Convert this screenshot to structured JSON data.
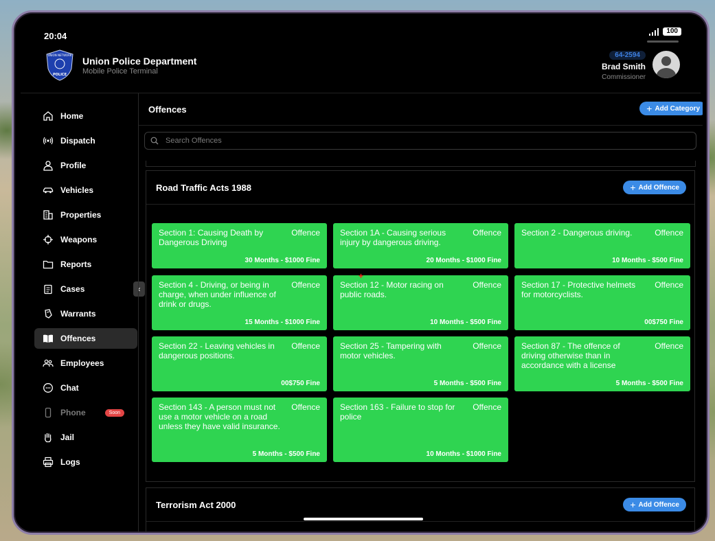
{
  "status": {
    "time": "20:04",
    "battery": "100"
  },
  "brand": {
    "title": "Union Police Department",
    "subtitle": "Mobile Police Terminal",
    "badge_top": "UNION NETWORK",
    "badge_bottom": "POLICE"
  },
  "user": {
    "callsign": "64-2594",
    "name": "Brad Smith",
    "rank": "Commissioner"
  },
  "nav": [
    {
      "label": "Home",
      "icon": "home-icon"
    },
    {
      "label": "Dispatch",
      "icon": "broadcast-icon"
    },
    {
      "label": "Profile",
      "icon": "user-icon"
    },
    {
      "label": "Vehicles",
      "icon": "car-icon"
    },
    {
      "label": "Properties",
      "icon": "building-icon"
    },
    {
      "label": "Weapons",
      "icon": "crosshair-icon"
    },
    {
      "label": "Reports",
      "icon": "folder-icon"
    },
    {
      "label": "Cases",
      "icon": "clipboard-icon"
    },
    {
      "label": "Warrants",
      "icon": "hand-paper-icon"
    },
    {
      "label": "Offences",
      "icon": "book-icon",
      "active": true
    },
    {
      "label": "Employees",
      "icon": "users-icon"
    },
    {
      "label": "Chat",
      "icon": "chat-icon"
    },
    {
      "label": "Phone",
      "icon": "phone-icon",
      "disabled": true,
      "badge": "Soon"
    },
    {
      "label": "Jail",
      "icon": "hand-icon"
    },
    {
      "label": "Logs",
      "icon": "printer-icon"
    }
  ],
  "main": {
    "title": "Offences",
    "add_category": "Add Category",
    "search_placeholder": "Search Offences",
    "categories": [
      {
        "title": "Road Traffic Acts 1988",
        "add_label": "Add Offence",
        "offences": [
          {
            "title": "Section 1: Causing Death by Dangerous Driving",
            "tag": "Offence",
            "fine": "30 Months - $1000 Fine"
          },
          {
            "title": "Section 1A - Causing serious injury by dangerous driving.",
            "tag": "Offence",
            "fine": "20 Months - $1000 Fine"
          },
          {
            "title": "Section 2 - Dangerous driving.",
            "tag": "Offence",
            "fine": "10 Months - $500 Fine"
          },
          {
            "title": "Section 4 - Driving, or being in charge, when under influence of drink or drugs.",
            "tag": "Offence",
            "fine": "15 Months - $1000 Fine"
          },
          {
            "title": "Section 12 - Motor racing on public roads.",
            "tag": "Offence",
            "fine": "10 Months - $500 Fine"
          },
          {
            "title": "Section 17 - Protective helmets for motorcyclists.",
            "tag": "Offence",
            "fine": "00$750 Fine"
          },
          {
            "title": "Section 22 - Leaving vehicles in dangerous positions.",
            "tag": "Offence",
            "fine": "00$750 Fine"
          },
          {
            "title": "Section 25 - Tampering with motor vehicles.",
            "tag": "Offence",
            "fine": "5 Months - $500 Fine"
          },
          {
            "title": "Section 87 - The offence of driving otherwise than in accordance with a license",
            "tag": "Offence",
            "fine": "5 Months - $500 Fine"
          },
          {
            "title": "Section 143 - A person must not use a motor vehicle on a road unless they have valid insurance.",
            "tag": "Offence",
            "fine": "5 Months - $500 Fine"
          },
          {
            "title": "Section 163 - Failure to stop for police",
            "tag": "Offence",
            "fine": "10 Months - $1000 Fine"
          }
        ]
      },
      {
        "title": "Terrorism Act 2000",
        "add_label": "Add Offence",
        "offences": []
      }
    ]
  },
  "colors": {
    "accent": "#3b8be6",
    "card": "#2fd451",
    "soon_badge": "#e34545",
    "frame": "#8e7fa8"
  }
}
